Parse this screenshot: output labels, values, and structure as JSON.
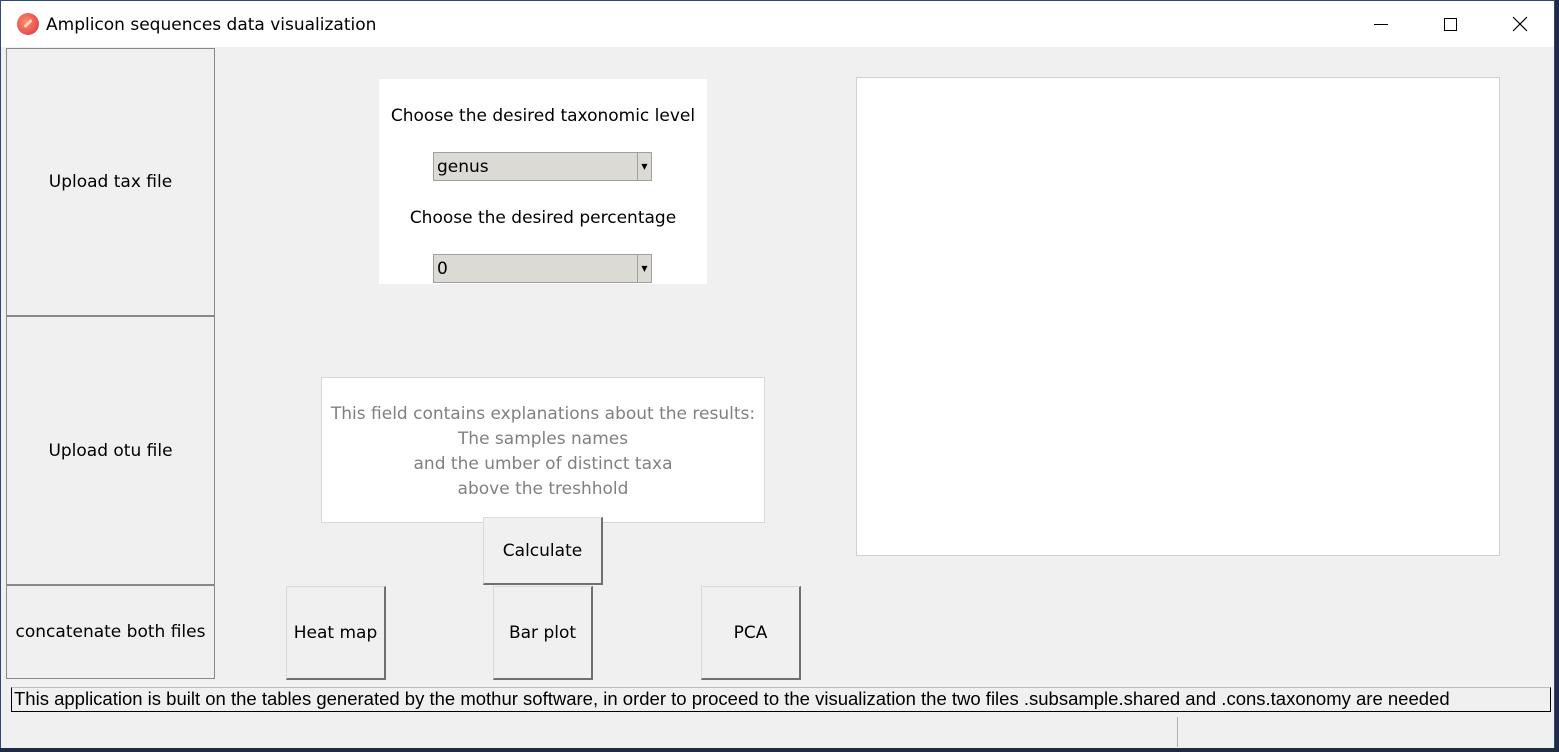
{
  "window": {
    "title": "Amplicon sequences data visualization",
    "controls": {
      "minimize": "minimize-icon",
      "maximize": "maximize-icon",
      "close": "close-icon"
    }
  },
  "sidebar": {
    "upload_tax": "Upload tax file",
    "upload_otu": "Upload otu file",
    "concatenate": "concatenate both files"
  },
  "options": {
    "taxonomic_label": "Choose the desired taxonomic level",
    "taxonomic_value": "genus",
    "percentage_label": "Choose the desired percentage",
    "percentage_value": "0"
  },
  "results": {
    "line1": "This field contains explanations about the results:",
    "line2": "The samples names",
    "line3": "and the umber of distinct taxa",
    "line4": "above the treshhold"
  },
  "buttons": {
    "calculate": "Calculate",
    "heat_map": "Heat map",
    "bar_plot": "Bar plot",
    "pca": "PCA"
  },
  "status": {
    "message": "This application is built on the tables generated by the mothur software, in order to proceed to the visualization the two files .subsample.shared and .cons.taxonomy are needed"
  }
}
